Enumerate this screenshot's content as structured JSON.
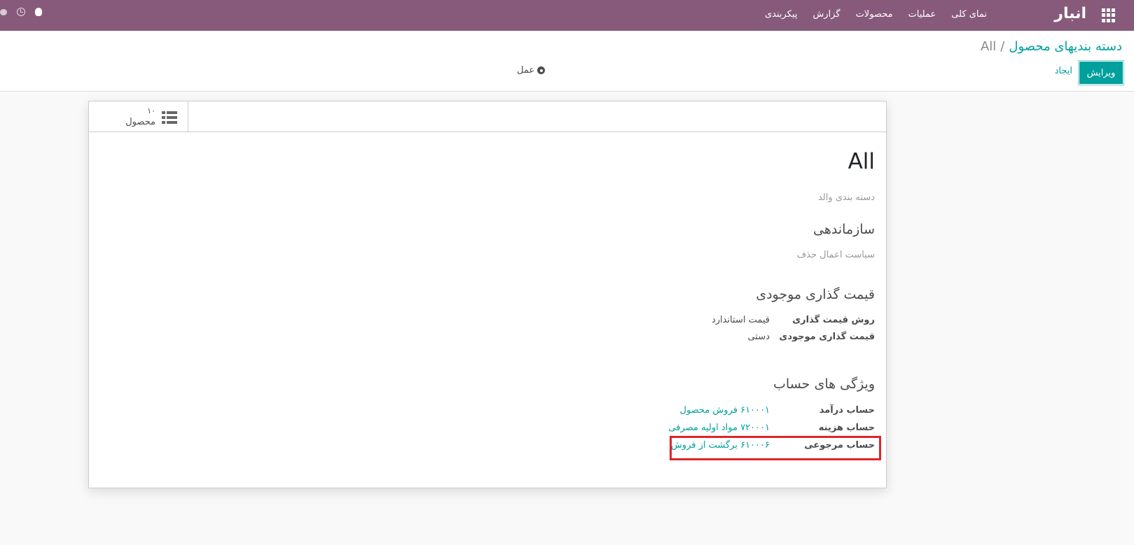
{
  "navbar": {
    "brand": "انبار",
    "menu": [
      "نمای کلی",
      "عملیات",
      "محصولات",
      "گزارش",
      "پیکربندی"
    ]
  },
  "breadcrumb": {
    "parent": "دسته بندیهای محصول",
    "separator": "/",
    "current": "All"
  },
  "buttons": {
    "edit": "ویرایش",
    "create": "ایجاد",
    "action": "عمل"
  },
  "stat_button": {
    "value": "۱۰",
    "text": "محصول"
  },
  "form": {
    "name": "All",
    "parent_placeholder": "دسته بندی والد",
    "logistics": {
      "title": "سازماندهی",
      "removal_strategy_placeholder": "سیاست اعمال حذف"
    },
    "valuation": {
      "title": "قیمت گذاری موجودی",
      "costing_method_label": "روش قیمت گذاری",
      "costing_method_value": "قیمت استاندارد",
      "valuation_label": "قیمت گذاری موجودی",
      "valuation_value": "دستی"
    },
    "accounts": {
      "title": "ویژگی های حساب",
      "income_label": "حساب درآمد",
      "income_value": "۶۱۰۰۰۱ فروش محصول",
      "expense_label": "حساب هزینه",
      "expense_value": "۷۲۰۰۰۱ مواد اولیه مصرفی",
      "refund_label": "حساب مرجوعی",
      "refund_value": "۶۱۰۰۰۶ برگشت از فروش"
    }
  },
  "colors": {
    "navbar": "#875a7b",
    "primary": "#00a09d",
    "highlight": "#e0242b"
  }
}
